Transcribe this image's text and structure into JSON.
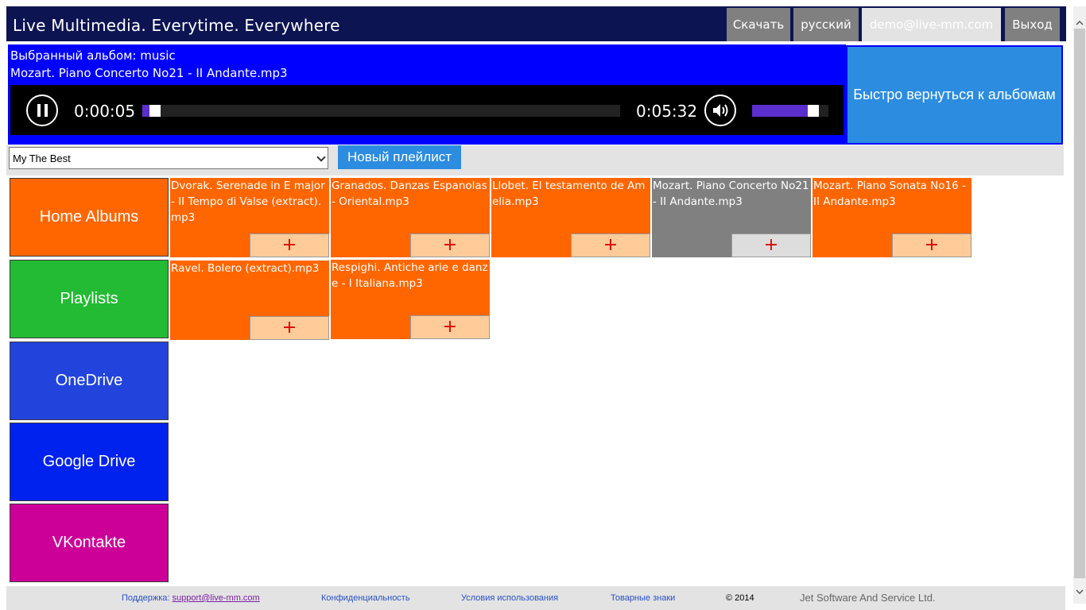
{
  "header": {
    "title": "Live Multimedia. Everytime. Everywhere",
    "download_label": "Скачать",
    "language_label": "русский",
    "account_label": "demo@live-mm.com",
    "logout_label": "Выход"
  },
  "player": {
    "album_line": "Выбранный альбом: music",
    "track_line": "Mozart. Piano Concerto No21 - II Andante.mp3",
    "time_current": "0:00:05",
    "time_total": "0:05:32",
    "progress_fraction": 0.015,
    "volume_fraction": 0.85,
    "state": "playing",
    "back_label": "Быстро вернуться к альбомам"
  },
  "playlist": {
    "selected": "My The Best",
    "new_label": "Новый плейлист"
  },
  "sidebar": {
    "items": [
      {
        "label": "Home Albums",
        "color": "#ff6600"
      },
      {
        "label": "Playlists",
        "color": "#22bb33"
      },
      {
        "label": "OneDrive",
        "color": "#2244dd"
      },
      {
        "label": "Google Drive",
        "color": "#0022ee"
      },
      {
        "label": "VKontakte",
        "color": "#cc0099"
      }
    ]
  },
  "tracks": [
    {
      "name": "Dvorak. Serenade in E major - II Tempo di Valse (extract).mp3",
      "add": "+"
    },
    {
      "name": "Granados. Danzas Espanolas - Oriental.mp3",
      "add": "+"
    },
    {
      "name": "Llobet. El testamento de Amelia.mp3",
      "add": "+"
    },
    {
      "name": "Mozart. Piano Concerto No21 - II Andante.mp3",
      "add": "+",
      "active": true
    },
    {
      "name": "Mozart. Piano Sonata No16 - II Andante.mp3",
      "add": "+"
    },
    {
      "name": "Ravel. Bolero (extract).mp3",
      "add": "+"
    },
    {
      "name": "Respighi. Antiche arie e danze - I Italiana.mp3",
      "add": "+"
    }
  ],
  "footer": {
    "support_label": "Поддержка:",
    "support_email": "support@live-mm.com",
    "privacy": "Конфиденциальность",
    "terms": "Условия использования",
    "trademarks": "Товарные знаки",
    "copyright": "© 2014",
    "company": "Jet Software And Service Ltd."
  }
}
